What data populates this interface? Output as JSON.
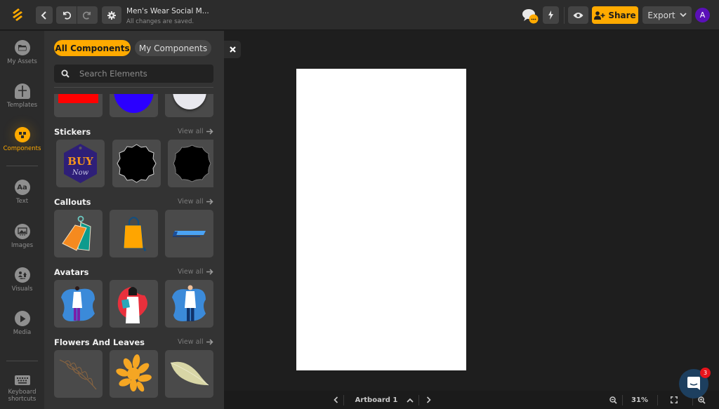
{
  "header": {
    "document_title": "Men's Wear Social M...",
    "save_status": "All changes are saved.",
    "share_label": "Share",
    "export_label": "Export",
    "avatar_initial": "A",
    "brand_color": "#ffaa00",
    "avatar_color": "#5a10b8"
  },
  "leftnav": {
    "items": [
      {
        "label": "My Assets",
        "icon": "folder-icon"
      },
      {
        "label": "Templates",
        "icon": "templates-icon"
      },
      {
        "label": "Components",
        "icon": "puzzle-icon",
        "active": true
      },
      {
        "label": "Text",
        "icon": "text-icon",
        "glyph": "Aa"
      },
      {
        "label": "Images",
        "icon": "image-icon"
      },
      {
        "label": "Visuals",
        "icon": "visuals-icon"
      },
      {
        "label": "Media",
        "icon": "play-icon"
      },
      {
        "label": "Keyboard shortcuts",
        "icon": "keyboard-icon"
      }
    ]
  },
  "panel": {
    "tabs": [
      {
        "label": "All Components",
        "active": true
      },
      {
        "label": "My Components",
        "active": false
      }
    ],
    "search": {
      "placeholder": "Search Elements",
      "value": ""
    },
    "view_all_label": "View all",
    "sections": [
      {
        "title": "Stickers",
        "items": [
          "Buy Now hexagon tag",
          "Black wavy badge",
          "Black scalloped badge"
        ],
        "sticker_text_1": "BUY",
        "sticker_text_2": "Now"
      },
      {
        "title": "Callouts",
        "items": [
          "Price tags",
          "Shopping bag",
          "Blue banner"
        ]
      },
      {
        "title": "Avatars",
        "items": [
          "Female doctor",
          "Doctor with clipboard",
          "Male doctor"
        ]
      },
      {
        "title": "Flowers And Leaves",
        "items": [
          "Brown branch",
          "Orange leaves",
          "Olive leaf"
        ]
      }
    ]
  },
  "canvas": {
    "artboard_name": "Artboard 1",
    "zoom_level": "31%"
  },
  "chat": {
    "unread_count": "3"
  }
}
